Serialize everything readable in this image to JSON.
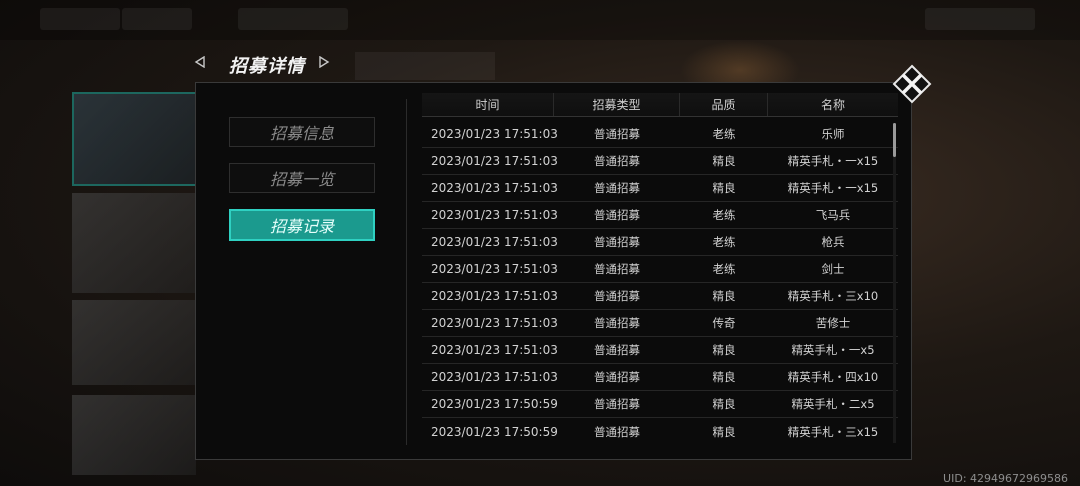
{
  "header": {
    "title": "招募详情",
    "left_arrow_icon": "triangle-left-icon",
    "right_arrow_icon": "triangle-right-icon"
  },
  "menu": {
    "items": [
      {
        "label": "招募信息",
        "active": false
      },
      {
        "label": "招募一览",
        "active": false
      },
      {
        "label": "招募记录",
        "active": true
      }
    ]
  },
  "table": {
    "columns": [
      "时间",
      "招募类型",
      "品质",
      "名称"
    ],
    "rows": [
      {
        "time": "2023/01/23 17:51:03",
        "type": "普通招募",
        "quality": "老练",
        "name": "乐师"
      },
      {
        "time": "2023/01/23 17:51:03",
        "type": "普通招募",
        "quality": "精良",
        "name": "精英手札・一x15"
      },
      {
        "time": "2023/01/23 17:51:03",
        "type": "普通招募",
        "quality": "精良",
        "name": "精英手札・一x15"
      },
      {
        "time": "2023/01/23 17:51:03",
        "type": "普通招募",
        "quality": "老练",
        "name": "飞马兵"
      },
      {
        "time": "2023/01/23 17:51:03",
        "type": "普通招募",
        "quality": "老练",
        "name": "枪兵"
      },
      {
        "time": "2023/01/23 17:51:03",
        "type": "普通招募",
        "quality": "老练",
        "name": "剑士"
      },
      {
        "time": "2023/01/23 17:51:03",
        "type": "普通招募",
        "quality": "精良",
        "name": "精英手札・三x10"
      },
      {
        "time": "2023/01/23 17:51:03",
        "type": "普通招募",
        "quality": "传奇",
        "name": "苦修士"
      },
      {
        "time": "2023/01/23 17:51:03",
        "type": "普通招募",
        "quality": "精良",
        "name": "精英手札・一x5"
      },
      {
        "time": "2023/01/23 17:51:03",
        "type": "普通招募",
        "quality": "精良",
        "name": "精英手札・四x10"
      },
      {
        "time": "2023/01/23 17:50:59",
        "type": "普通招募",
        "quality": "精良",
        "name": "精英手札・二x5"
      },
      {
        "time": "2023/01/23 17:50:59",
        "type": "普通招募",
        "quality": "精良",
        "name": "精英手札・三x15"
      }
    ]
  },
  "close_icon": "close-x-icon",
  "uid_text": "UID: 42949672969586",
  "colors": {
    "accent": "#1b9a8e",
    "accent_border": "#2fd1c2",
    "panel_bg": "#0b0b0b"
  }
}
